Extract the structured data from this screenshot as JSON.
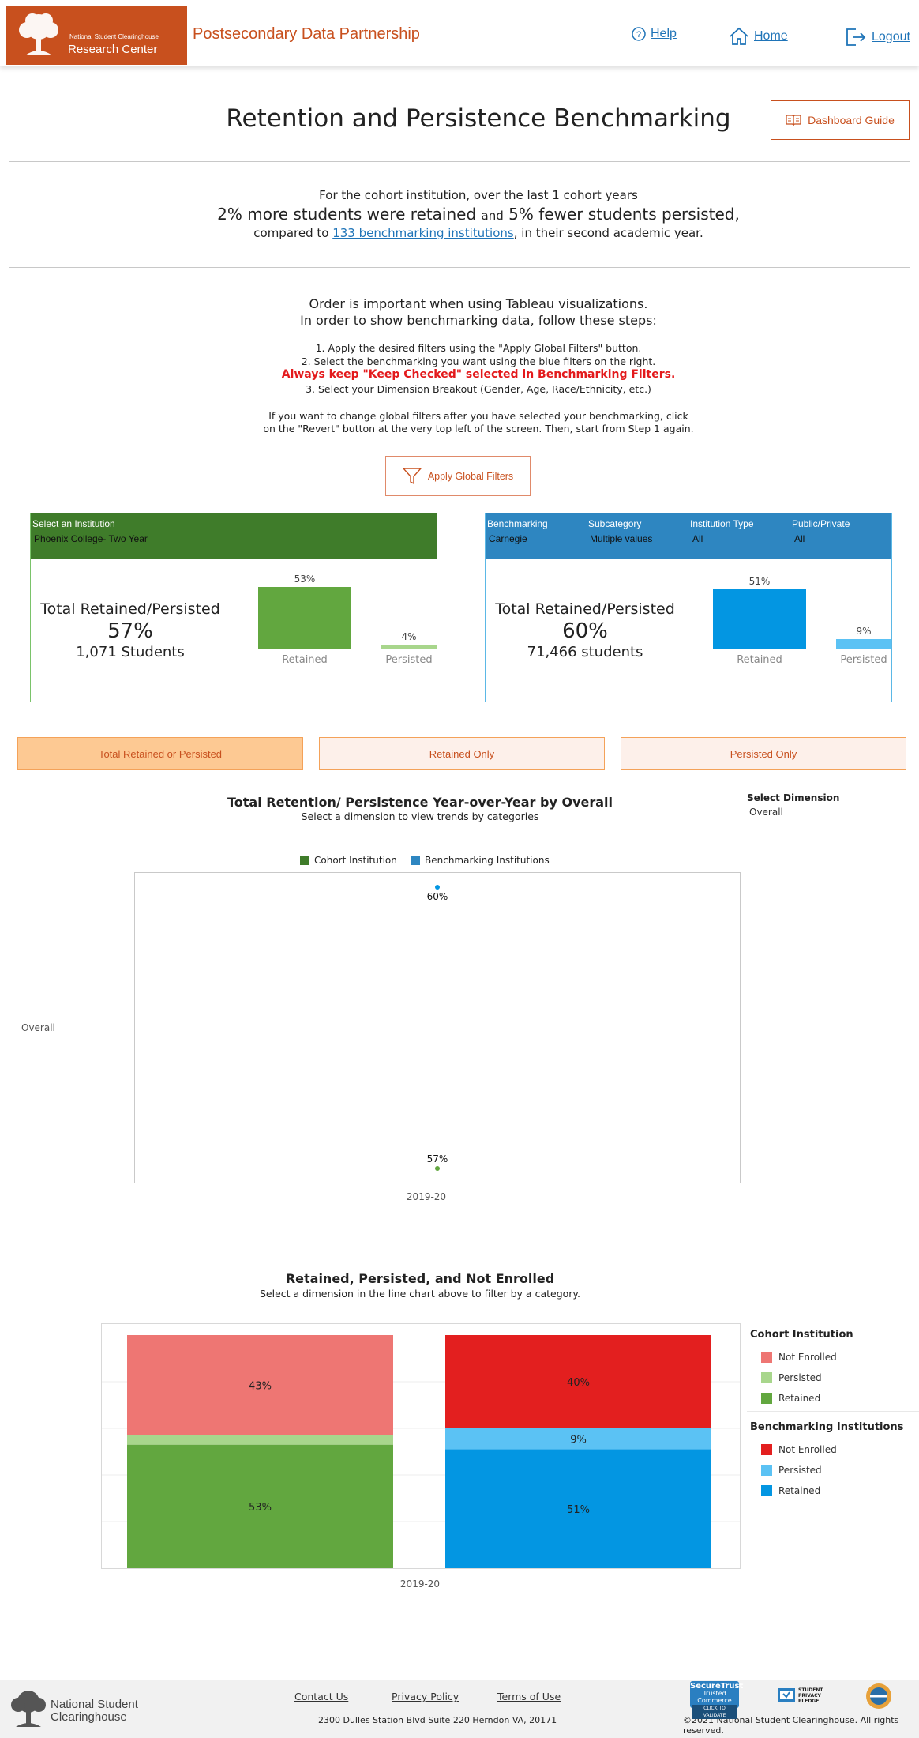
{
  "header": {
    "logo_small": "National Student Clearinghouse",
    "logo_big": "Research Center",
    "brand": "Postsecondary Data Partnership",
    "nav": {
      "help": "Help",
      "home": "Home",
      "logout": "Logout"
    }
  },
  "page": {
    "title": "Retention and Persistence Benchmarking",
    "guide_button": "Dashboard Guide"
  },
  "summary": {
    "line1": "For the cohort institution, over the last 1 cohort years",
    "retained_text": "2% more students were retained",
    "and_text": "and",
    "persisted_text": "5% fewer students persisted",
    "comma": ",",
    "compared_prefix": "compared to",
    "benchmark_link": "133 benchmarking institutions",
    "compared_suffix": ", in their second academic year."
  },
  "instructions": {
    "line1": "Order is important when using Tableau visualizations.",
    "line2": "In order to show benchmarking data, follow these steps:",
    "step1": "1. Apply the desired filters using the \"Apply Global Filters\" button.",
    "step2": "2. Select the benchmarking you want using the blue filters on the right.",
    "warning": "Always keep \"Keep Checked\" selected in Benchmarking Filters.",
    "step3": "3. Select your Dimension Breakout (Gender, Age, Race/Ethnicity, etc.)",
    "note1": "If you want to change global filters after you have selected your benchmarking, click",
    "note2": "on the \"Revert\" button at the very top left of the screen. Then, start from Step 1 again.",
    "apply_button": "Apply Global Filters"
  },
  "cohort_panel": {
    "select_label": "Select an Institution",
    "institution": "Phoenix College- Two Year",
    "kpi_title": "Total Retained/Persisted",
    "kpi_pct": "57%",
    "kpi_students": "1,071 Students",
    "bars": [
      {
        "label": "Retained",
        "value": 53,
        "value_text": "53%"
      },
      {
        "label": "Persisted",
        "value": 4,
        "value_text": "4%"
      }
    ]
  },
  "bench_panel": {
    "filters": [
      {
        "label": "Benchmarking",
        "value": "Carnegie"
      },
      {
        "label": "Subcategory",
        "value": "Multiple values"
      },
      {
        "label": "Institution Type",
        "value": "All"
      },
      {
        "label": "Public/Private",
        "value": "All"
      }
    ],
    "kpi_title": "Total Retained/Persisted",
    "kpi_pct": "60%",
    "kpi_students": "71,466 students",
    "bars": [
      {
        "label": "Retained",
        "value": 51,
        "value_text": "51%"
      },
      {
        "label": "Persisted",
        "value": 9,
        "value_text": "9%"
      }
    ]
  },
  "tabs": [
    {
      "label": "Total Retained or Persisted",
      "active": true
    },
    {
      "label": "Retained Only",
      "active": false
    },
    {
      "label": "Persisted Only",
      "active": false
    }
  ],
  "trend_chart": {
    "title": "Total Retention/ Persistence Year-over-Year by Overall",
    "subtitle": "Select a dimension to view trends by categories",
    "select_dimension_label": "Select Dimension",
    "select_dimension_value": "Overall",
    "row_label": "Overall",
    "legend": [
      {
        "name": "Cohort Institution",
        "color": "#3f7c2a"
      },
      {
        "name": "Benchmarking Institutions",
        "color": "#2e86c1"
      }
    ]
  },
  "stack_chart": {
    "title": "Retained, Persisted, and Not Enrolled",
    "subtitle": "Select a dimension in the line chart above to filter by a category.",
    "legend_cohort_title": "Cohort Institution",
    "legend_bench_title": "Benchmarking Institutions",
    "legend_cohort": [
      {
        "name": "Not Enrolled",
        "color": "#ee7673"
      },
      {
        "name": "Persisted",
        "color": "#a8d68c"
      },
      {
        "name": "Retained",
        "color": "#62a73f"
      }
    ],
    "legend_bench": [
      {
        "name": "Not Enrolled",
        "color": "#e31f1f"
      },
      {
        "name": "Persisted",
        "color": "#5bc2f4"
      },
      {
        "name": "Retained",
        "color": "#0396e2"
      }
    ]
  },
  "chart_data": [
    {
      "type": "scatter",
      "title": "Total Retention/ Persistence Year-over-Year by Overall",
      "x": [
        "2019-20"
      ],
      "series": [
        {
          "name": "Cohort Institution",
          "values": [
            57
          ],
          "labels": [
            "57%"
          ],
          "color": "#62a73f"
        },
        {
          "name": "Benchmarking Institutions",
          "values": [
            60
          ],
          "labels": [
            "60%"
          ],
          "color": "#0396e2"
        }
      ],
      "ylim": [
        57,
        60
      ]
    },
    {
      "type": "bar",
      "stacked": true,
      "title": "Retained, Persisted, and Not Enrolled",
      "categories": [
        "2019-20"
      ],
      "bars": [
        {
          "group": "Cohort Institution",
          "segments": [
            {
              "name": "Retained",
              "value": 53,
              "label": "53%",
              "color": "#62a73f"
            },
            {
              "name": "Persisted",
              "value": 4,
              "label": "",
              "color": "#a8d68c"
            },
            {
              "name": "Not Enrolled",
              "value": 43,
              "label": "43%",
              "color": "#ee7673"
            }
          ]
        },
        {
          "group": "Benchmarking Institutions",
          "segments": [
            {
              "name": "Retained",
              "value": 51,
              "label": "51%",
              "color": "#0396e2"
            },
            {
              "name": "Persisted",
              "value": 9,
              "label": "9%",
              "color": "#5bc2f4"
            },
            {
              "name": "Not Enrolled",
              "value": 40,
              "label": "40%",
              "color": "#e31f1f"
            }
          ]
        }
      ],
      "ylim": [
        0,
        100
      ]
    }
  ],
  "footer": {
    "logo_line1": "National Student",
    "logo_line2": "Clearinghouse",
    "links": [
      "Contact Us",
      "Privacy Policy",
      "Terms of Use"
    ],
    "address": "2300 Dulles Station Blvd Suite 220 Herndon VA, 20171",
    "copyright": "©2021 National Student Clearinghouse. All rights reserved.",
    "badge_securetrust_1": "SecureTrust",
    "badge_securetrust_2": "Trusted Commerce",
    "badge_securetrust_3": "CLICK TO VALIDATE",
    "badge_pledge": "STUDENT PRIVACY PLEDGE"
  }
}
